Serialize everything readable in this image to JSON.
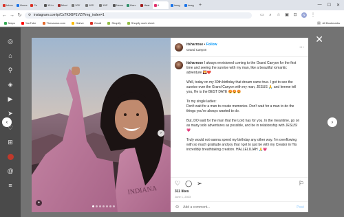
{
  "browser": {
    "tabs": [
      {
        "label": "Inbox",
        "color": "#d93025"
      },
      {
        "label": "Home",
        "color": "#1a73e8"
      },
      {
        "label": "Co",
        "color": "#d93025"
      },
      {
        "label": "15 in",
        "color": "#555555"
      },
      {
        "label": "Misci",
        "color": "#9c2f2f"
      },
      {
        "label": "105'",
        "color": "#777777"
      },
      {
        "label": "105'",
        "color": "#777777"
      },
      {
        "label": "105'",
        "color": "#777777"
      },
      {
        "label": "News",
        "color": "#555555"
      },
      {
        "label": "Harv",
        "color": "#2f8f6a"
      },
      {
        "label": "Hear",
        "color": "#a01d1d"
      },
      {
        "label": "II",
        "color": "#e1306c",
        "active": true
      },
      {
        "label": "imag",
        "color": "#1a73e8"
      },
      {
        "label": "imag",
        "color": "#1a73e8"
      }
    ],
    "new_tab": "+",
    "url": "instagram.com/p/CsTK9GP1VZ/?img_index=1",
    "bookmarks": [
      {
        "label": "Maps",
        "color": "#34a853"
      },
      {
        "label": "YouTube",
        "color": "#ff0000"
      },
      {
        "label": "Thesaurus.com",
        "color": "#e36c2f"
      },
      {
        "label": "Gdrive",
        "color": "#fbbc04"
      },
      {
        "label": "Gmail",
        "color": "#d93025"
      },
      {
        "label": "Shopify",
        "color": "#95bf47"
      },
      {
        "label": "Shopify work sheet",
        "color": "#95bf47"
      }
    ],
    "all_bookmarks": "All Bookmarks",
    "profile_initial": "N"
  },
  "post": {
    "username": "itsharrose",
    "follow": "Follow",
    "separator": "•",
    "location": "Grand Canyon",
    "caption_user": "itsharrose",
    "caption": "I always envisioned coming to the Grand Canyon for the first time and seeing the sunrise with my man, like a beautiful romantic adventure 🌄❤️\n\nWell, today on my 30th birthday that dream came true. I got to see the sunrise over the Grand Canyon with my man, JESUS 🙏 and lemme tell you, He is the BEST DATE 😍😍😍\n\nTo my single ladies:\nDon't wait for a man to create memories. Don't wait for a man to do the things you've always wanted to do.\n\nBut, DO wait for the man that the Lord has for you. In the meantime, go on as many solo adventures as possible, and be in relationship with JESUS! 💗\n\nTruly would not wanna spend my birthday any other way. I'm overflowing with so much gratitude and joy that I get to just be with my Creator in His incredibly breathtaking creation. HALLELUJAH 🙏💗",
    "likes": "311 likes",
    "date": "June 1, 2023",
    "comment_placeholder": "Add a comment...",
    "post_label": "Post",
    "carousel_count": 7
  }
}
